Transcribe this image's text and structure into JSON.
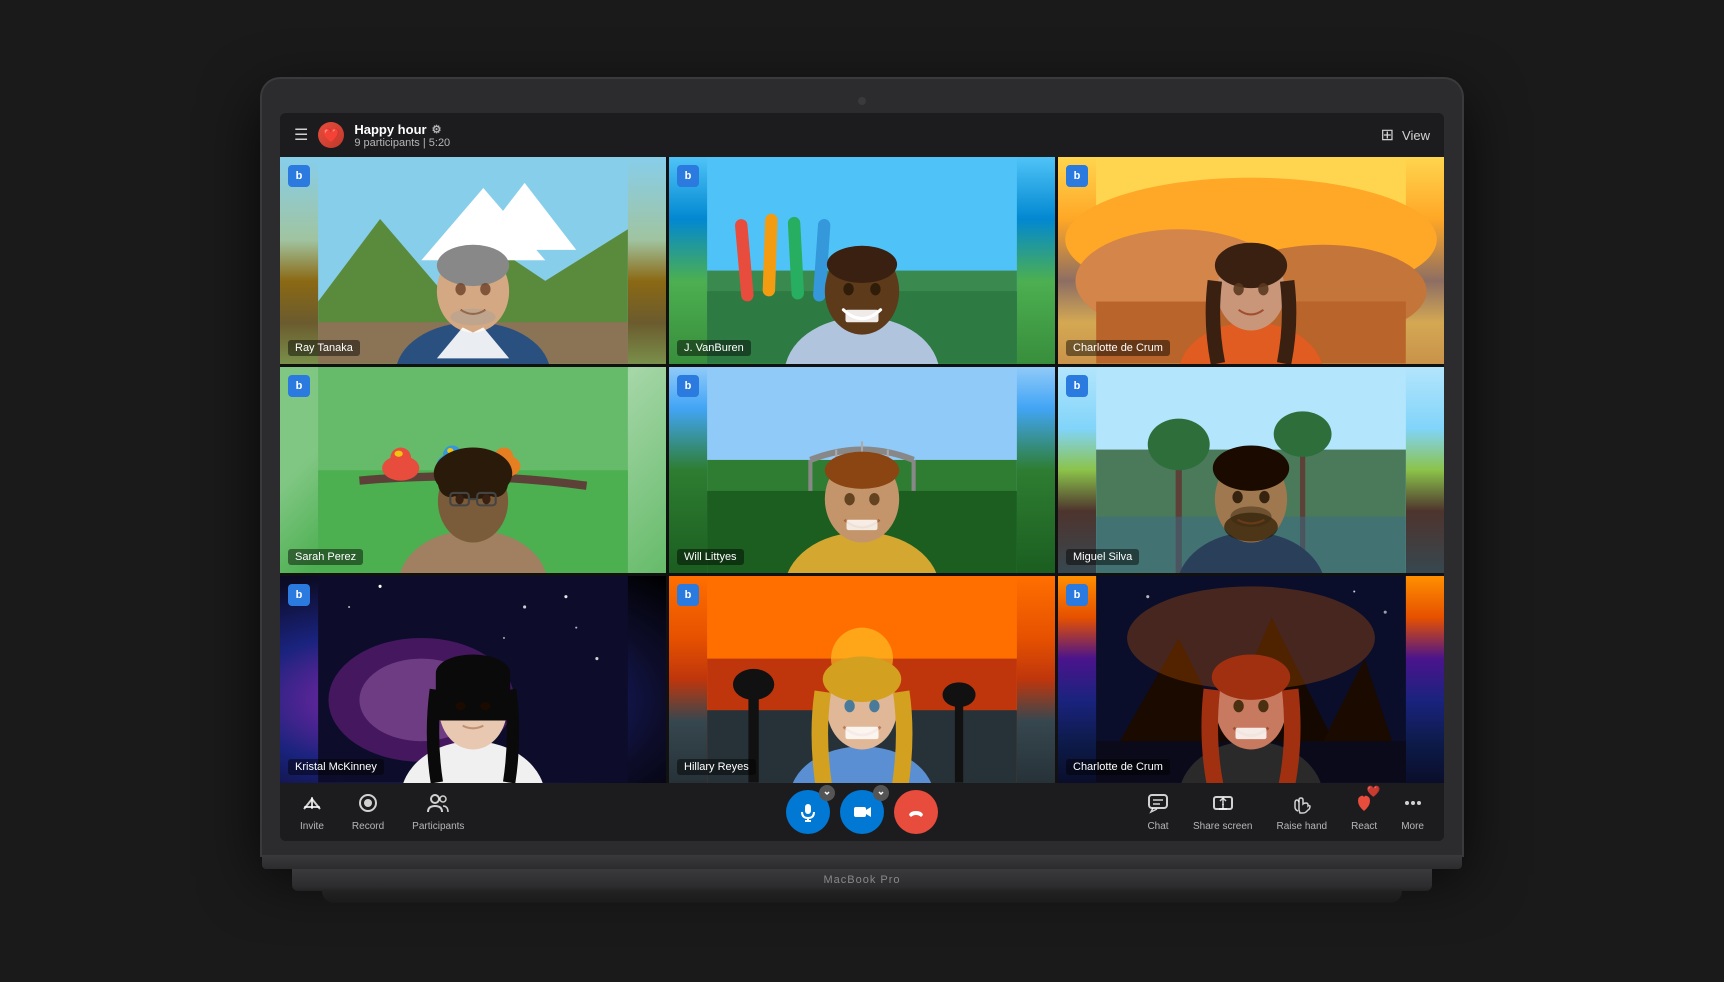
{
  "meeting": {
    "title": "Happy hour",
    "participants_count": "9 participants",
    "timer": "5:20",
    "view_label": "View"
  },
  "participants": [
    {
      "id": "ray-tanaka",
      "name": "Ray Tanaka",
      "bg": "mountains",
      "position": 0
    },
    {
      "id": "j-vanburen",
      "name": "J. VanBuren",
      "bg": "tropical",
      "position": 1
    },
    {
      "id": "charlotte-de-crum-1",
      "name": "Charlotte de Crum",
      "bg": "desert",
      "position": 2
    },
    {
      "id": "sarah-perez",
      "name": "Sarah Perez",
      "bg": "birds",
      "position": 3
    },
    {
      "id": "will-littyes",
      "name": "Will Littyes",
      "bg": "valley",
      "position": 4
    },
    {
      "id": "miguel-silva",
      "name": "Miguel Silva",
      "bg": "mangrove",
      "position": 5
    },
    {
      "id": "kristal-mckinney",
      "name": "Kristal McKinney",
      "bg": "galaxy",
      "position": 6
    },
    {
      "id": "hillary-reyes",
      "name": "Hillary Reyes",
      "bg": "sunset",
      "position": 7
    },
    {
      "id": "charlotte-de-crum-2",
      "name": "Charlotte de Crum",
      "bg": "volcano",
      "position": 8
    }
  ],
  "toolbar": {
    "left": [
      {
        "id": "invite",
        "label": "Invite",
        "icon": "↑□"
      },
      {
        "id": "record",
        "label": "Record",
        "icon": "⊙"
      },
      {
        "id": "participants",
        "label": "Participants",
        "icon": "👥"
      }
    ],
    "center": [
      {
        "id": "mic",
        "label": "",
        "icon": "🎤",
        "color": "blue",
        "has_chevron": true
      },
      {
        "id": "camera",
        "label": "",
        "icon": "📷",
        "color": "blue",
        "has_chevron": true
      },
      {
        "id": "end-call",
        "label": "",
        "icon": "✆",
        "color": "red"
      }
    ],
    "right": [
      {
        "id": "chat",
        "label": "Chat",
        "icon": "💬"
      },
      {
        "id": "share-screen",
        "label": "Share screen",
        "icon": "⬆"
      },
      {
        "id": "raise-hand",
        "label": "Raise hand",
        "icon": "✋"
      },
      {
        "id": "react",
        "label": "React",
        "icon": "♡",
        "badge": "❤️"
      },
      {
        "id": "more",
        "label": "More",
        "icon": "⋯"
      }
    ]
  },
  "laptop_label": "MacBook Pro"
}
